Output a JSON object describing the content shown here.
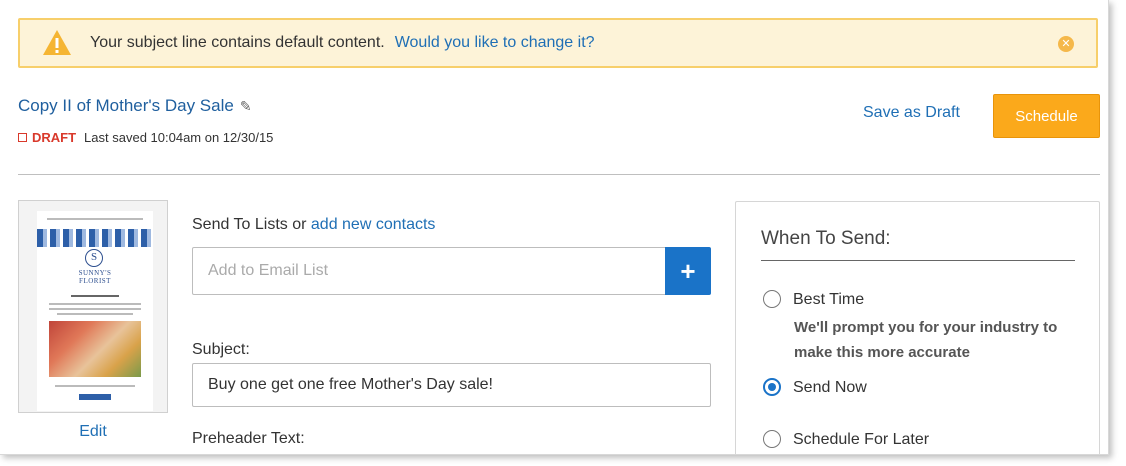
{
  "alert": {
    "message": "Your subject line contains default content.",
    "link": "Would you like to change it?"
  },
  "campaign": {
    "title": "Copy II of Mother's Day Sale",
    "status": "DRAFT",
    "last_saved": "Last saved 10:04am on 12/30/15"
  },
  "actions": {
    "save_draft": "Save as Draft",
    "schedule": "Schedule"
  },
  "preview": {
    "edit": "Edit",
    "brand": "SUNNY'S FLORIST"
  },
  "form": {
    "send_to_prefix": "Send To Lists or",
    "send_to_link": "add new contacts",
    "list_placeholder": "Add to Email List",
    "add_button": "+",
    "subject_label": "Subject:",
    "subject_value": "Buy one get one free Mother's Day sale!",
    "preheader_label": "Preheader Text:"
  },
  "when_to_send": {
    "heading": "When To Send:",
    "options": [
      {
        "label": "Best Time",
        "checked": false
      },
      {
        "label": "Send Now",
        "checked": true
      },
      {
        "label": "Schedule For Later",
        "checked": false
      }
    ],
    "best_time_hint": "We'll prompt you for your industry to make this more accurate"
  },
  "colors": {
    "accent": "#1a73c8",
    "link": "#1f6fb5",
    "schedule": "#fba91b",
    "warning_bg": "#fdf3d8",
    "draft": "#d9392b"
  }
}
